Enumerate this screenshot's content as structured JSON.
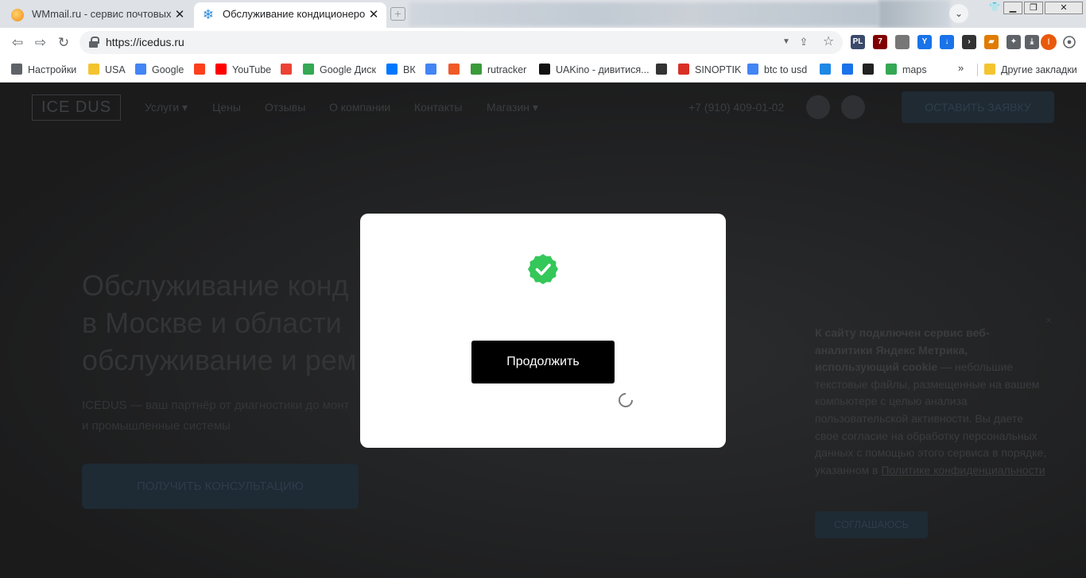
{
  "tabs": [
    {
      "title": "WMmail.ru - сервис почтовых рассылок",
      "active": false
    },
    {
      "title": "Обслуживание кондиционеров и",
      "active": true
    }
  ],
  "toolbar": {
    "url": "https://icedus.ru"
  },
  "extensions": [
    {
      "name": "pl-extension-icon",
      "badge": "PL",
      "color": "#3b4a6b"
    },
    {
      "name": "ublock-icon",
      "badge": "7",
      "color": "#800000"
    },
    {
      "name": "briefcase-extension-icon",
      "badge": "",
      "color": "#777777"
    },
    {
      "name": "y-extension-icon",
      "badge": "Y",
      "color": "#1a73e8"
    },
    {
      "name": "download-arrow-extension-icon",
      "badge": "↓",
      "color": "#1a73e8"
    },
    {
      "name": "terminal-extension-icon",
      "badge": "›",
      "color": "#333333"
    },
    {
      "name": "chart-extension-icon",
      "badge": "▰",
      "color": "#e07b00"
    },
    {
      "name": "puzzle-extensions-icon",
      "badge": "✦",
      "color": "#5f6368"
    },
    {
      "name": "downloads-icon",
      "badge": "⤓",
      "color": "#5f6368"
    }
  ],
  "profile_initial": "I",
  "bookmarks": [
    {
      "label": "Настройки",
      "icon": "gear-icon",
      "color": "#5f6368"
    },
    {
      "label": "USA",
      "icon": "folder-icon",
      "color": "#f4c430"
    },
    {
      "label": "Google",
      "icon": "google-icon",
      "color": "#4285f4"
    },
    {
      "label": "",
      "icon": "yandex-icon",
      "color": "#fc3f1d"
    },
    {
      "label": "YouTube",
      "icon": "youtube-icon",
      "color": "#ff0000"
    },
    {
      "label": "",
      "icon": "gmail-icon",
      "color": "#ea4335"
    },
    {
      "label": "Google Диск",
      "icon": "google-drive-icon",
      "color": "#34a853"
    },
    {
      "label": "ВК",
      "icon": "vk-icon",
      "color": "#0077ff"
    },
    {
      "label": "",
      "icon": "google-translate-icon",
      "color": "#4285f4"
    },
    {
      "label": "",
      "icon": "f-bookmark-icon",
      "color": "#f05a28"
    },
    {
      "label": "rutracker",
      "icon": "rutracker-icon",
      "color": "#3a9a3a"
    },
    {
      "label": "UAKino - дивитися...",
      "icon": "uakino-icon",
      "color": "#111111"
    },
    {
      "label": "",
      "icon": "chess-knight-icon",
      "color": "#333333"
    },
    {
      "label": "SINOPTIK",
      "icon": "thermometer-icon",
      "color": "#d93025"
    },
    {
      "label": "btc to usd",
      "icon": "google-icon",
      "color": "#4285f4"
    },
    {
      "label": "",
      "icon": "p-bookmark-icon",
      "color": "#1e88e5"
    },
    {
      "label": "",
      "icon": "chevron-bookmark-icon",
      "color": "#1a73e8"
    },
    {
      "label": "",
      "icon": "bc-bookmark-icon",
      "color": "#222222"
    },
    {
      "label": "maps",
      "icon": "maps-pin-icon",
      "color": "#34a853"
    }
  ],
  "other_bookmarks": "Другие закладки",
  "site": {
    "logo": "ICE  DUS",
    "nav": [
      "Услуги ▾",
      "Цены",
      "Отзывы",
      "О компании",
      "Контакты",
      "Магазин ▾"
    ],
    "phone": "+7 (910) 409-01-02",
    "cta_top": "ОСТАВИТЬ ЗАЯВКУ",
    "hero_title_lines": [
      "Обслуживание конд",
      "в Москве и области",
      "обслуживание и рем"
    ],
    "hero_sub_lines": [
      "ICEDUS — ваш партнёр от диагностики до монт",
      "и промышленные системы"
    ],
    "hero_button": "ПОЛУЧИТЬ КОНСУЛЬТАЦИЮ",
    "cookie": {
      "bold": "К сайту подключен сервис веб-аналитики Яндекс Метрика, использующий cookie",
      "text": " — небольшие текстовые файлы, размещенные на вашем компьютере с целью анализа пользовательской активности. Вы даете свое согласие на обработку персональных данных с помощью этого сервиса в порядке, указанном в ",
      "link": "Политике конфиденциальности",
      "button": "СОГЛАШАЮСЬ"
    }
  },
  "modal": {
    "icon": "verified-check-icon",
    "accent": "#34c759",
    "button": "Продолжить"
  }
}
